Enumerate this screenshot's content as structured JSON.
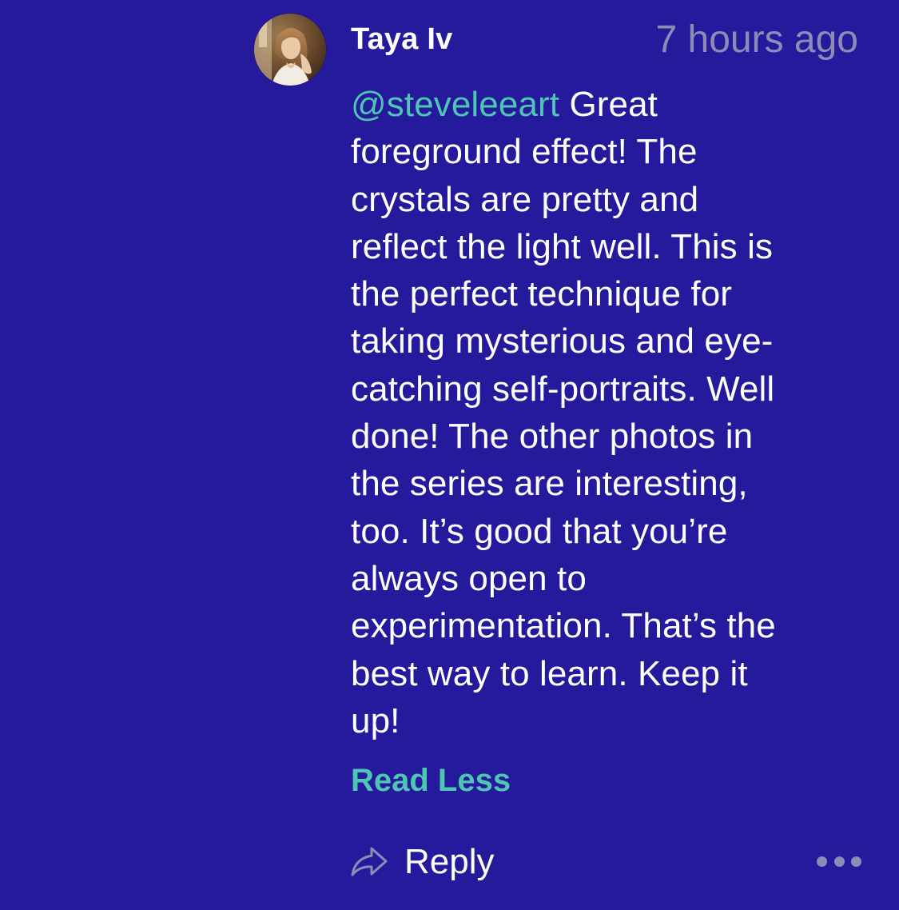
{
  "comment": {
    "author": "Taya Iv",
    "timestamp": "7 hours ago",
    "mention": "@steveleeart",
    "body": "Great\nforeground effect! The\ncrystals are pretty and\nreflect the light well. This is\nthe perfect technique for\ntaking mysterious and eye-\ncatching self-portraits. Well\ndone! The other photos in\nthe series are interesting,\ntoo. It’s good that you’re\nalways open to\nexperimentation. That’s the\nbest way to learn. Keep it\nup!",
    "read_less_label": "Read Less",
    "reply_label": "Reply",
    "avatar_icon": "user-avatar-photo",
    "reply_icon": "reply-arrow-icon",
    "more_icon": "more-options-icon"
  },
  "colors": {
    "background": "#251a9c",
    "accent": "#4fc6b3",
    "muted": "#8e8cb7",
    "text": "#ffffff"
  }
}
